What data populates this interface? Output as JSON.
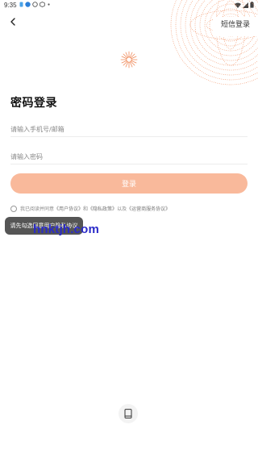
{
  "status_bar": {
    "time": "9:35",
    "left_icons": [
      "notification-icon",
      "blue-app-icon",
      "circle-app-icon",
      "cube-app-icon",
      "dot-icon"
    ],
    "right_icons": [
      "wifi-icon",
      "signal-icon",
      "battery-icon"
    ]
  },
  "header": {
    "back_icon": "chevron-left-icon",
    "sms_login_label": "短信登录"
  },
  "title": "密码登录",
  "form": {
    "phone_placeholder": "请输入手机号/邮箱",
    "password_placeholder": "请输入密码",
    "login_button_label": "登录"
  },
  "agreement": {
    "prefix": "我已阅读并同意",
    "user_agreement": "《用户协议》",
    "and": "和",
    "privacy_policy": "《隐私政策》",
    "mid": "以及",
    "telecom_agreement": "《运营商服务协议》"
  },
  "toast": "请先勾选同意用户隐私协议",
  "watermark": "hnktjh.com",
  "bottom": {
    "device_icon": "phone-device-icon"
  },
  "colors": {
    "accent": "#f9b99b",
    "decor": "#f08a5a",
    "watermark": "#2a2ac8"
  }
}
